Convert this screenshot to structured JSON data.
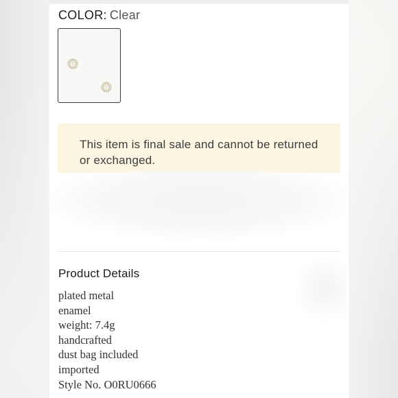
{
  "product": {
    "color_label": "COLOR:",
    "color_value": "Clear",
    "swatch_name": "Clear",
    "notice": "This item is final sale and cannot be returned or exchanged.",
    "details_title": "Product Details",
    "details": [
      "plated metal",
      "enamel",
      "weight: 7.4g",
      "handcrafted",
      "dust bag included",
      "imported",
      "Style No. O0RU0666"
    ]
  },
  "colors": {
    "notice_bg": "#fbf5e1",
    "swatch_border": "#3a3a3a"
  }
}
